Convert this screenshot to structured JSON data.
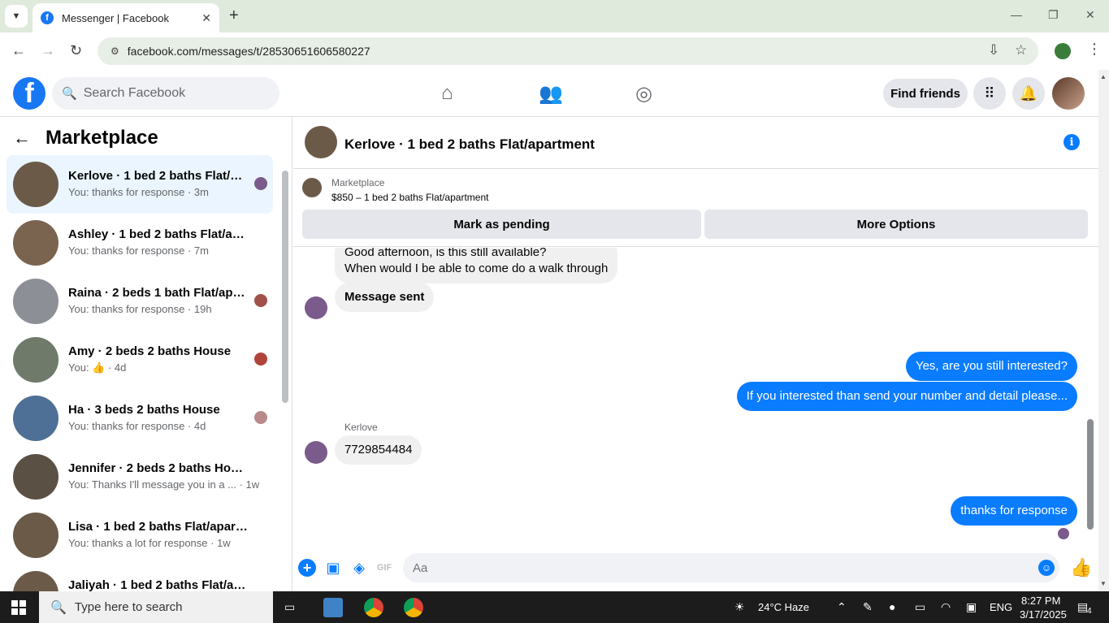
{
  "browser": {
    "tab_title": "Messenger | Facebook",
    "url": "facebook.com/messages/t/28530651606580227"
  },
  "fb": {
    "search_placeholder": "Search Facebook",
    "find_friends": "Find friends"
  },
  "sidebar": {
    "title": "Marketplace",
    "conversations": [
      {
        "name": "Kerlove · 1 bed 2 baths Flat/apartment",
        "last": "You: thanks for response · 3m",
        "thumb": "#6b5a48"
      },
      {
        "name": "Ashley · 1 bed 2 baths Flat/apartment",
        "last": "You: thanks for response · 7m",
        "thumb": "#7a6450"
      },
      {
        "name": "Raina · 2 beds 1 bath Flat/apartment",
        "last": "You: thanks for response · 19h",
        "thumb": "#8c8f96"
      },
      {
        "name": "Amy · 2 beds 2 baths House",
        "last": "You: 👍 · 4d",
        "thumb": "#6f7a6a"
      },
      {
        "name": "Ha · 3 beds 2 baths House",
        "last": "You: thanks for response · 4d",
        "thumb": "#4e6f96"
      },
      {
        "name": "Jennifer · 2 beds 2 baths House",
        "last": "You: Thanks I'll message you in a ...  · 1w",
        "thumb": "#5b5044"
      },
      {
        "name": "Lisa · 1 bed 2 baths Flat/apartment",
        "last": "You: thanks a lot for response · 1w",
        "thumb": "#6b5a48"
      },
      {
        "name": "Jaliyah · 1 bed 2 baths Flat/apartment",
        "last": "",
        "thumb": "#6b5a48"
      }
    ]
  },
  "chat": {
    "title": "Kerlove · 1 bed 2 baths Flat/apartment",
    "listing_source": "Marketplace",
    "listing_price": "$850 – 1 bed 2 baths Flat/apartment",
    "btn_pending": "Mark as pending",
    "btn_more": "More Options",
    "msg1_line1": "Good afternoon, is this still available?",
    "msg1_line2": "When would I be able to come do a walk through",
    "msg2": "Message sent",
    "out1": "Yes, are you still interested?",
    "out2": "If you interested than send your number and detail please...",
    "sender": "Kerlove",
    "msg3": "7729854484",
    "out3": "thanks for response",
    "composer_placeholder": "Aa"
  },
  "taskbar": {
    "search": "Type here to search",
    "weather": "24°C  Haze",
    "lang": "ENG",
    "time": "8:27 PM",
    "date": "3/17/2025",
    "notif_count": "4"
  },
  "colors": {
    "fb_blue": "#1877f2",
    "messenger_blue": "#0a7cff",
    "active_conv": "#ebf5ff"
  }
}
